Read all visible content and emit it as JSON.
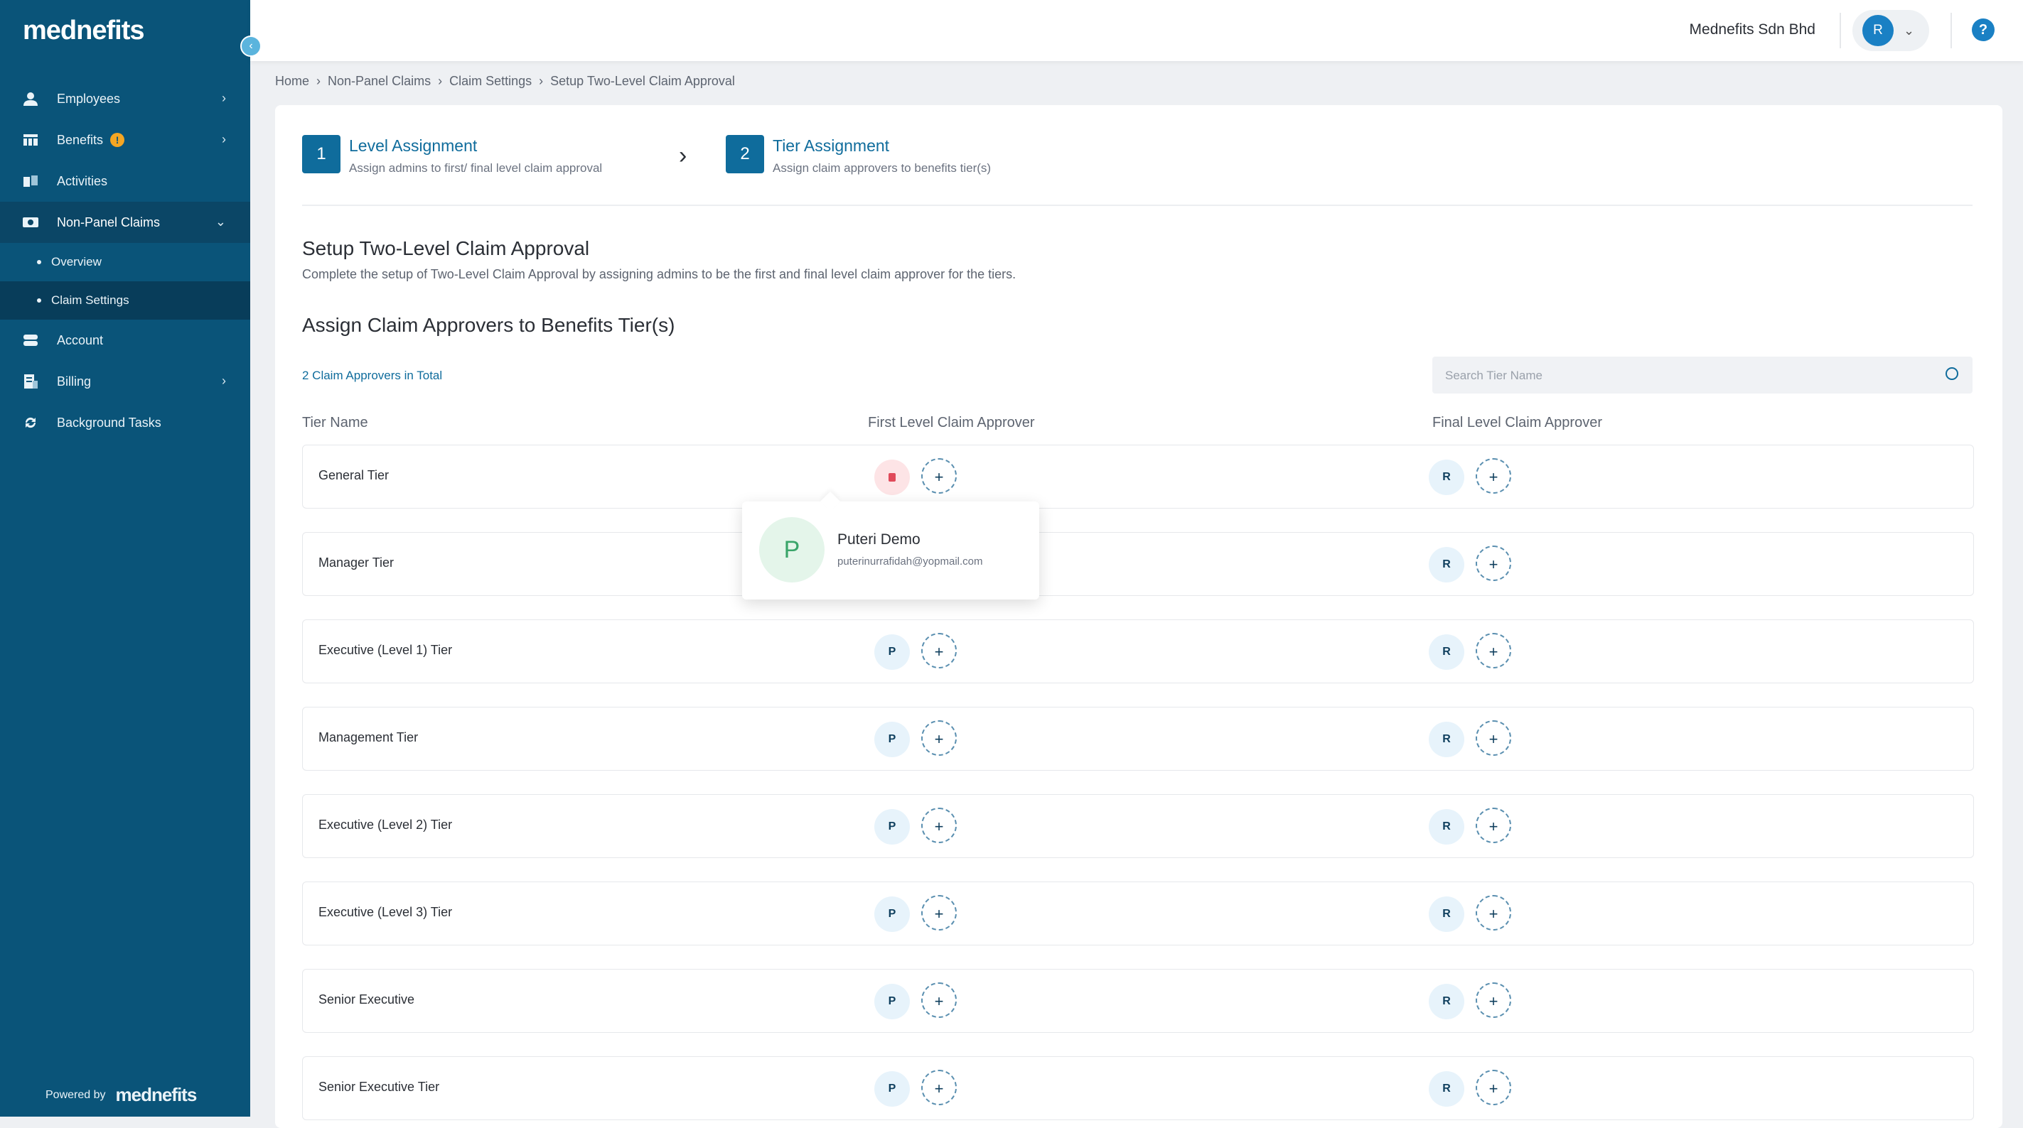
{
  "app": {
    "logo_text": "mednefits",
    "company": "Mednefits Sdn Bhd",
    "user_initial": "R",
    "powered_by": "Powered by",
    "powered_logo": "mednefits"
  },
  "sidebar": {
    "items": [
      {
        "label": "Employees",
        "icon": "employees-icon"
      },
      {
        "label": "Benefits",
        "icon": "benefits-icon",
        "badge": "!"
      },
      {
        "label": "Activities",
        "icon": "activities-icon"
      },
      {
        "label": "Non-Panel Claims",
        "icon": "claims-icon"
      },
      {
        "label": "Account",
        "icon": "account-icon"
      },
      {
        "label": "Billing",
        "icon": "billing-icon"
      },
      {
        "label": "Background Tasks",
        "icon": "sync-icon"
      }
    ],
    "sub_items": [
      {
        "label": "Overview"
      },
      {
        "label": "Claim Settings"
      }
    ]
  },
  "breadcrumb": [
    "Home",
    "Non-Panel Claims",
    "Claim Settings",
    "Setup Two-Level Claim Approval"
  ],
  "stepper": {
    "step1": {
      "number": "1",
      "title": "Level Assignment",
      "subtitle": "Assign admins to first/ final level claim approval"
    },
    "step2": {
      "number": "2",
      "title": "Tier Assignment",
      "subtitle": "Assign claim approvers to benefits tier(s)"
    }
  },
  "section": {
    "title": "Setup Two-Level Claim Approval",
    "description": "Complete the setup of Two-Level Claim Approval by assigning admins to be the first and final level claim approver for the tiers.",
    "assign_title": "Assign Claim Approvers to Benefits Tier(s)",
    "count_text": "2 Claim Approvers in Total"
  },
  "search": {
    "placeholder": "Search Tier Name"
  },
  "table": {
    "headers": [
      "Tier Name",
      "First Level Claim Approver",
      "Final Level Claim Approver"
    ],
    "rows": [
      {
        "name": "General Tier",
        "first": "",
        "final": "R"
      },
      {
        "name": "Manager Tier",
        "first": "P",
        "final": "R"
      },
      {
        "name": "Executive (Level 1) Tier",
        "first": "P",
        "final": "R"
      },
      {
        "name": "Management Tier",
        "first": "P",
        "final": "R"
      },
      {
        "name": "Executive (Level 2) Tier",
        "first": "P",
        "final": "R"
      },
      {
        "name": "Executive (Level 3) Tier",
        "first": "P",
        "final": "R"
      },
      {
        "name": "Senior Executive",
        "first": "P",
        "final": "R"
      },
      {
        "name": "Senior Executive Tier",
        "first": "P",
        "final": "R"
      }
    ],
    "add_symbol": "+"
  },
  "popover": {
    "initial": "P",
    "name": "Puteri Demo",
    "email": "puterinurrafidah@yopmail.com"
  }
}
